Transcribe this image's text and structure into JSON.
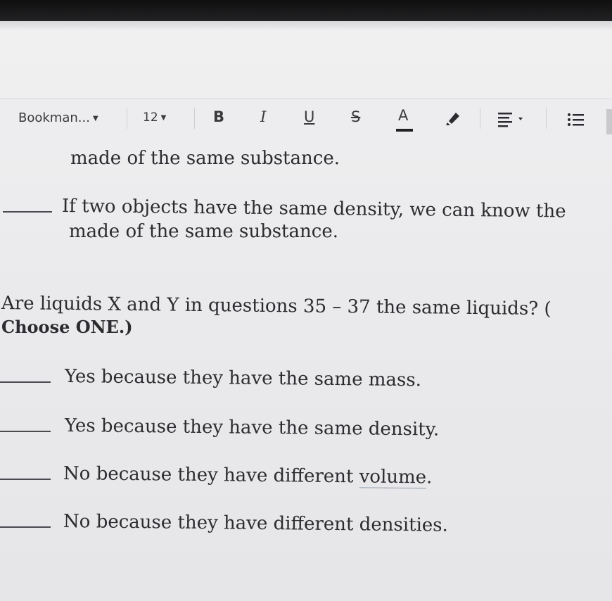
{
  "toolbar": {
    "font_name": "Bookman...",
    "font_size": "12",
    "bold_label": "B",
    "italic_label": "I",
    "underline_label": "U",
    "strike_label": "S",
    "text_color_label": "A",
    "icons": {
      "highlight": "highlighter-icon",
      "align": "align-left-icon",
      "bullets": "bulleted-list-icon"
    }
  },
  "document": {
    "continuation_line": "made of the same substance.",
    "statement": {
      "line1": "If two objects have the same density, we can know the",
      "line2": "made of the same substance."
    },
    "question": {
      "line1": "Are liquids X and Y in questions 35 – 37 the same liquids? (",
      "line2": "Choose ONE.)"
    },
    "options": [
      {
        "pre": "Yes because they have the same mass.",
        "underlined": "",
        "post": ""
      },
      {
        "pre": "Yes because they have the same density.",
        "underlined": "",
        "post": ""
      },
      {
        "pre": "No because they have different ",
        "underlined": "volume",
        "post": "."
      },
      {
        "pre": "No because they have different densities.",
        "underlined": "",
        "post": ""
      }
    ]
  }
}
